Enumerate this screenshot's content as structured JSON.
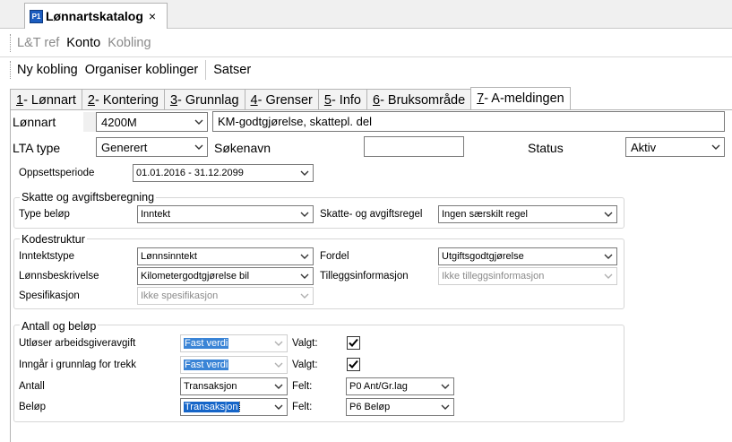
{
  "document_tab": {
    "icon": "P1",
    "title": "Lønnartskatalog",
    "close": "×"
  },
  "toolbar1": {
    "lt_ref": "L&T ref",
    "konto": "Konto",
    "kobling": "Kobling"
  },
  "toolbar2": {
    "ny_kobling": "Ny kobling",
    "organiser": "Organiser koblinger",
    "satser": "Satser"
  },
  "tabs": [
    {
      "num": "1",
      "label": " - Lønnart"
    },
    {
      "num": "2",
      "label": " - Kontering"
    },
    {
      "num": "3",
      "label": " - Grunnlag"
    },
    {
      "num": "4",
      "label": " - Grenser"
    },
    {
      "num": "5",
      "label": " - Info"
    },
    {
      "num": "6",
      "label": " - Bruksområde"
    },
    {
      "num": "7",
      "label": " - A-meldingen"
    }
  ],
  "header": {
    "lonnart_label": "Lønnart",
    "lonnart_value": "4200M",
    "lonnart_desc": "KM-godtgjørelse, skattepl. del",
    "lta_label": "LTA type",
    "lta_value": "Generert",
    "sokenavn_label": "Søkenavn",
    "sokenavn_value": "",
    "status_label": "Status",
    "status_value": "Aktiv"
  },
  "period": {
    "label": "Oppsettsperiode",
    "value": "01.01.2016 - 31.12.2099"
  },
  "skatte": {
    "title": "Skatte og avgiftsberegning",
    "type_belop_label": "Type beløp",
    "type_belop_value": "Inntekt",
    "regel_label": "Skatte- og avgiftsregel",
    "regel_value": "Ingen særskilt regel"
  },
  "kode": {
    "title": "Kodestruktur",
    "inntektstype_label": "Inntektstype",
    "inntektstype_value": "Lønnsinntekt",
    "fordel_label": "Fordel",
    "fordel_value": "Utgiftsgodtgjørelse",
    "lonnsbeskrivelse_label": "Lønnsbeskrivelse",
    "lonnsbeskrivelse_value": "Kilometergodtgjørelse bil",
    "tillegg_label": "Tilleggsinformasjon",
    "tillegg_value": "Ikke tilleggsinformasjon",
    "spesifikasjon_label": "Spesifikasjon",
    "spesifikasjon_value": "Ikke spesifikasjon"
  },
  "antall": {
    "title": "Antall og beløp",
    "rows": [
      {
        "label": "Utløser arbeidsgiveravgift",
        "value": "Fast verdi",
        "valgt_label": "Valgt:",
        "checked": true
      },
      {
        "label": "Inngår i grunnlag for trekk",
        "value": "Fast verdi",
        "valgt_label": "Valgt:",
        "checked": true
      },
      {
        "label": "Antall",
        "value": "Transaksjon",
        "felt_label": "Felt:",
        "felt_value": "P0  Ant/Gr.lag"
      },
      {
        "label": "Beløp",
        "value": "Transaksjon",
        "felt_label": "Felt:",
        "felt_value": "P6  Beløp"
      }
    ]
  }
}
